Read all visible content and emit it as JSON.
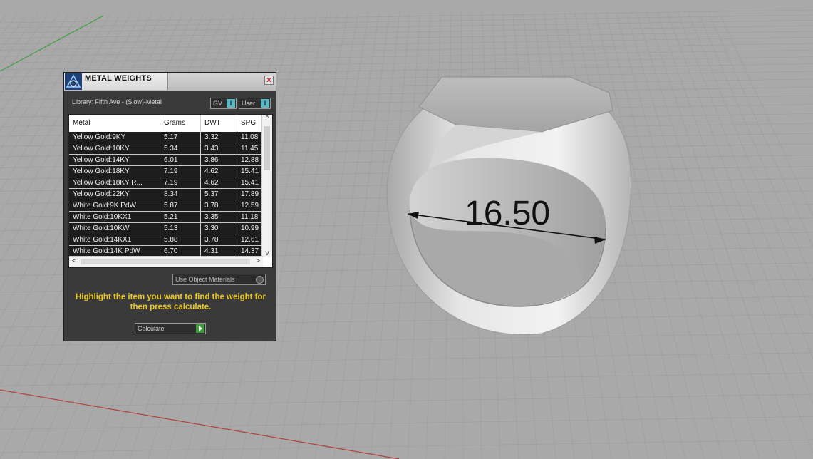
{
  "dialog": {
    "title": "METAL WEIGHTS",
    "close_glyph": "✕",
    "library": "Library: Fifth Ave - (Slow)-Metal",
    "toggle_gv": "GV",
    "toggle_user": "User",
    "toggle_knob": "I",
    "columns": [
      "Metal",
      "Grams",
      "DWT",
      "SPG"
    ],
    "rows": [
      [
        "Yellow Gold:9KY",
        "5.17",
        "3.32",
        "11.08"
      ],
      [
        "Yellow Gold:10KY",
        "5.34",
        "3.43",
        "11.45"
      ],
      [
        "Yellow Gold:14KY",
        "6.01",
        "3.86",
        "12.88"
      ],
      [
        "Yellow Gold:18KY",
        "7.19",
        "4.62",
        "15.41"
      ],
      [
        "Yellow Gold:18KY R...",
        "7.19",
        "4.62",
        "15.41"
      ],
      [
        "Yellow Gold:22KY",
        "8.34",
        "5.37",
        "17.89"
      ],
      [
        "White Gold:9K PdW",
        "5.87",
        "3.78",
        "12.59"
      ],
      [
        "White Gold:10KX1",
        "5.21",
        "3.35",
        "11.18"
      ],
      [
        "White Gold:10KW",
        "5.13",
        "3.30",
        "10.99"
      ],
      [
        "White Gold:14KX1",
        "5.88",
        "3.78",
        "12.61"
      ],
      [
        "White Gold:14K PdW",
        "6.70",
        "4.31",
        "14.37"
      ]
    ],
    "scroll_up": "^",
    "scroll_down": "v",
    "scroll_left": "<",
    "scroll_right": ">",
    "use_object_materials": "Use Object Materials",
    "hint": "Highlight the item you want to find the weight for then press calculate.",
    "calculate_label": "Calculate"
  },
  "viewport": {
    "dimension_value": "16.50",
    "colors": {
      "grid": "#9c9c9c",
      "ring": "#cfcfcf",
      "x_axis": "#b04040",
      "y_axis": "#3f9f3f"
    }
  }
}
